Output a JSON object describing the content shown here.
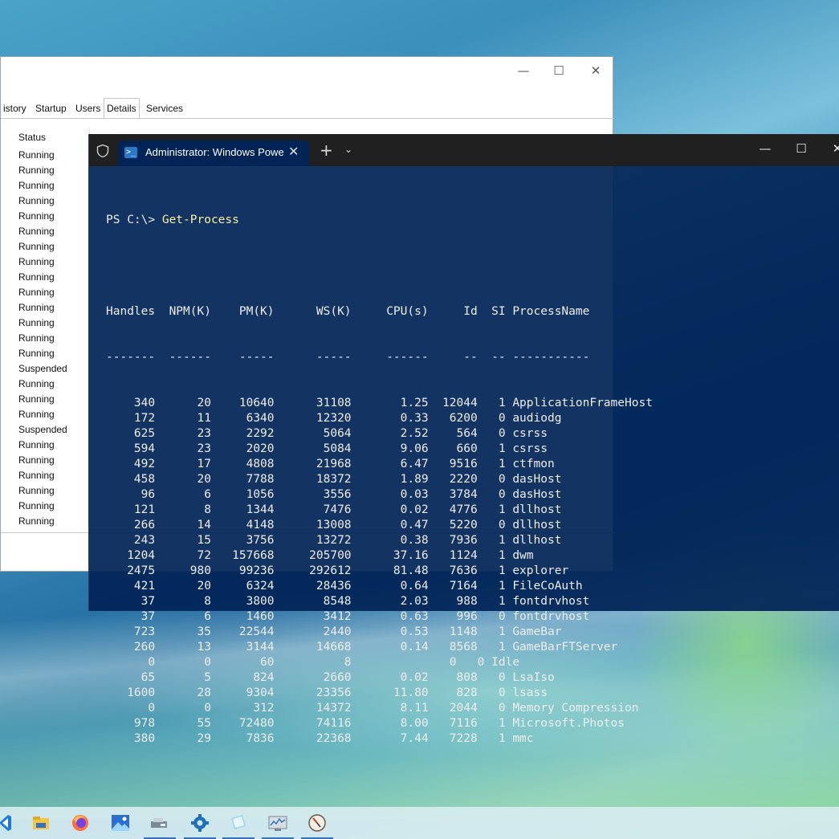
{
  "task_manager": {
    "tabs": [
      "History",
      "Startup",
      "Users",
      "Details",
      "Services"
    ],
    "tab_visible_text": [
      "istory",
      "Startup",
      "Users",
      "Details",
      "Services"
    ],
    "active_tab": "Details",
    "status_header": "Status",
    "statuses": [
      "Running",
      "Running",
      "Running",
      "Running",
      "Running",
      "Running",
      "Running",
      "Running",
      "Running",
      "Running",
      "Running",
      "Running",
      "Running",
      "Running",
      "Suspended",
      "Running",
      "Running",
      "Running",
      "Suspended",
      "Running",
      "Running",
      "Running",
      "Running",
      "Running",
      "Running"
    ],
    "controls": {
      "minimize": "—",
      "maximize": "☐",
      "close": "✕"
    }
  },
  "terminal": {
    "tab_title": "Administrator: Windows Powe",
    "new_tab_label": "+",
    "dropdown_label": "⌄",
    "controls": {
      "minimize": "—",
      "maximize": "☐",
      "close": "✕"
    },
    "prompt": "PS C:\\> ",
    "command": "Get-Process",
    "header": "Handles  NPM(K)    PM(K)      WS(K)     CPU(s)     Id  SI ProcessName",
    "separator": "-------  ------    -----      -----     ------     --  -- -----------",
    "rows": [
      "    340      20    10640      31108       1.25  12044   1 ApplicationFrameHost",
      "    172      11     6340      12320       0.33   6200   0 audiodg",
      "    625      23     2292       5064       2.52    564   0 csrss",
      "    594      23     2020       5084       9.06    660   1 csrss",
      "    492      17     4808      21968       6.47   9516   1 ctfmon",
      "    458      20     7788      18372       1.89   2220   0 dasHost",
      "     96       6     1056       3556       0.03   3784   0 dasHost",
      "    121       8     1344       7476       0.02   4776   1 dllhost",
      "    266      14     4148      13008       0.47   5220   0 dllhost",
      "    243      15     3756      13272       0.38   7936   1 dllhost",
      "   1204      72   157668     205700      37.16   1124   1 dwm",
      "   2475     980    99236     292612      81.48   7636   1 explorer",
      "    421      20     6324      28436       0.64   7164   1 FileCoAuth",
      "     37       8     3800       8548       2.03    988   1 fontdrvhost",
      "     37       6     1460       3412       0.63    996   0 fontdrvhost",
      "    723      35    22544       2440       0.53   1148   1 GameBar",
      "    260      13     3144      14668       0.14   8568   1 GameBarFTServer",
      "      0       0       60          8              0   0 Idle",
      "     65       5      824       2660       0.02    808   0 LsaIso",
      "   1600      28     9304      23356      11.80    828   0 lsass",
      "      0       0      312      14372       8.11   2044   0 Memory Compression",
      "    978      55    72480      74116       8.00   7116   1 Microsoft.Photos",
      "    380      29     7836      22368       7.44   7228   1 mmc"
    ]
  },
  "taskbar": {
    "icons": [
      "vscode-icon",
      "file-explorer-icon",
      "firefox-icon",
      "photos-icon",
      "app-icon",
      "settings-app-icon",
      "notepad-icon",
      "performance-monitor-icon",
      "clock-app-icon"
    ]
  },
  "colors": {
    "terminal_bg": "#012456",
    "terminal_text": "#eeedf0",
    "command_text": "#f9f1a5",
    "tabbar_bg": "#202020"
  }
}
